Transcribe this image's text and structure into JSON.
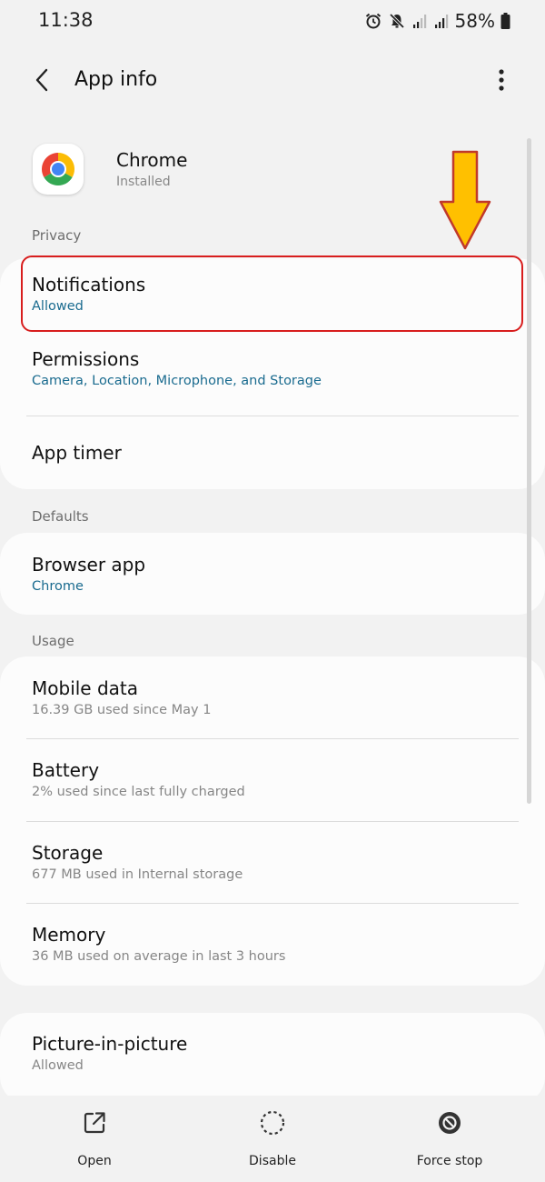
{
  "status_bar": {
    "time": "11:38",
    "battery": "58%",
    "icons": [
      "alarm-icon",
      "mute-icon",
      "signal-icon",
      "signal-icon",
      "battery-icon"
    ]
  },
  "app_bar": {
    "title": "App info",
    "back_icon": "back-arrow-icon",
    "more_icon": "more-vert-icon"
  },
  "app": {
    "name": "Chrome",
    "status": "Installed",
    "icon": "chrome-logo"
  },
  "sections": {
    "privacy": "Privacy",
    "defaults": "Defaults",
    "usage": "Usage"
  },
  "privacy_items": [
    {
      "title": "Notifications",
      "subtitle": "Allowed"
    },
    {
      "title": "Permissions",
      "subtitle": "Camera, Location, Microphone, and Storage"
    },
    {
      "title": "App timer"
    }
  ],
  "defaults_items": [
    {
      "title": "Browser app",
      "subtitle": "Chrome"
    }
  ],
  "usage_items": [
    {
      "title": "Mobile data",
      "subtitle": "16.39 GB used since May 1"
    },
    {
      "title": "Battery",
      "subtitle": "2% used since last fully charged"
    },
    {
      "title": "Storage",
      "subtitle": "677 MB used in Internal storage"
    },
    {
      "title": "Memory",
      "subtitle": "36 MB used on average in last 3 hours"
    }
  ],
  "extra_items": [
    {
      "title": "Picture-in-picture",
      "subtitle": "Allowed"
    }
  ],
  "bottom_bar": {
    "open": "Open",
    "disable": "Disable",
    "force_stop": "Force stop"
  },
  "colors": {
    "accent_link": "#1a6b8f",
    "highlight_border": "#d81e1e",
    "arrow_fill": "#ffc000",
    "arrow_stroke": "#c0392b"
  }
}
